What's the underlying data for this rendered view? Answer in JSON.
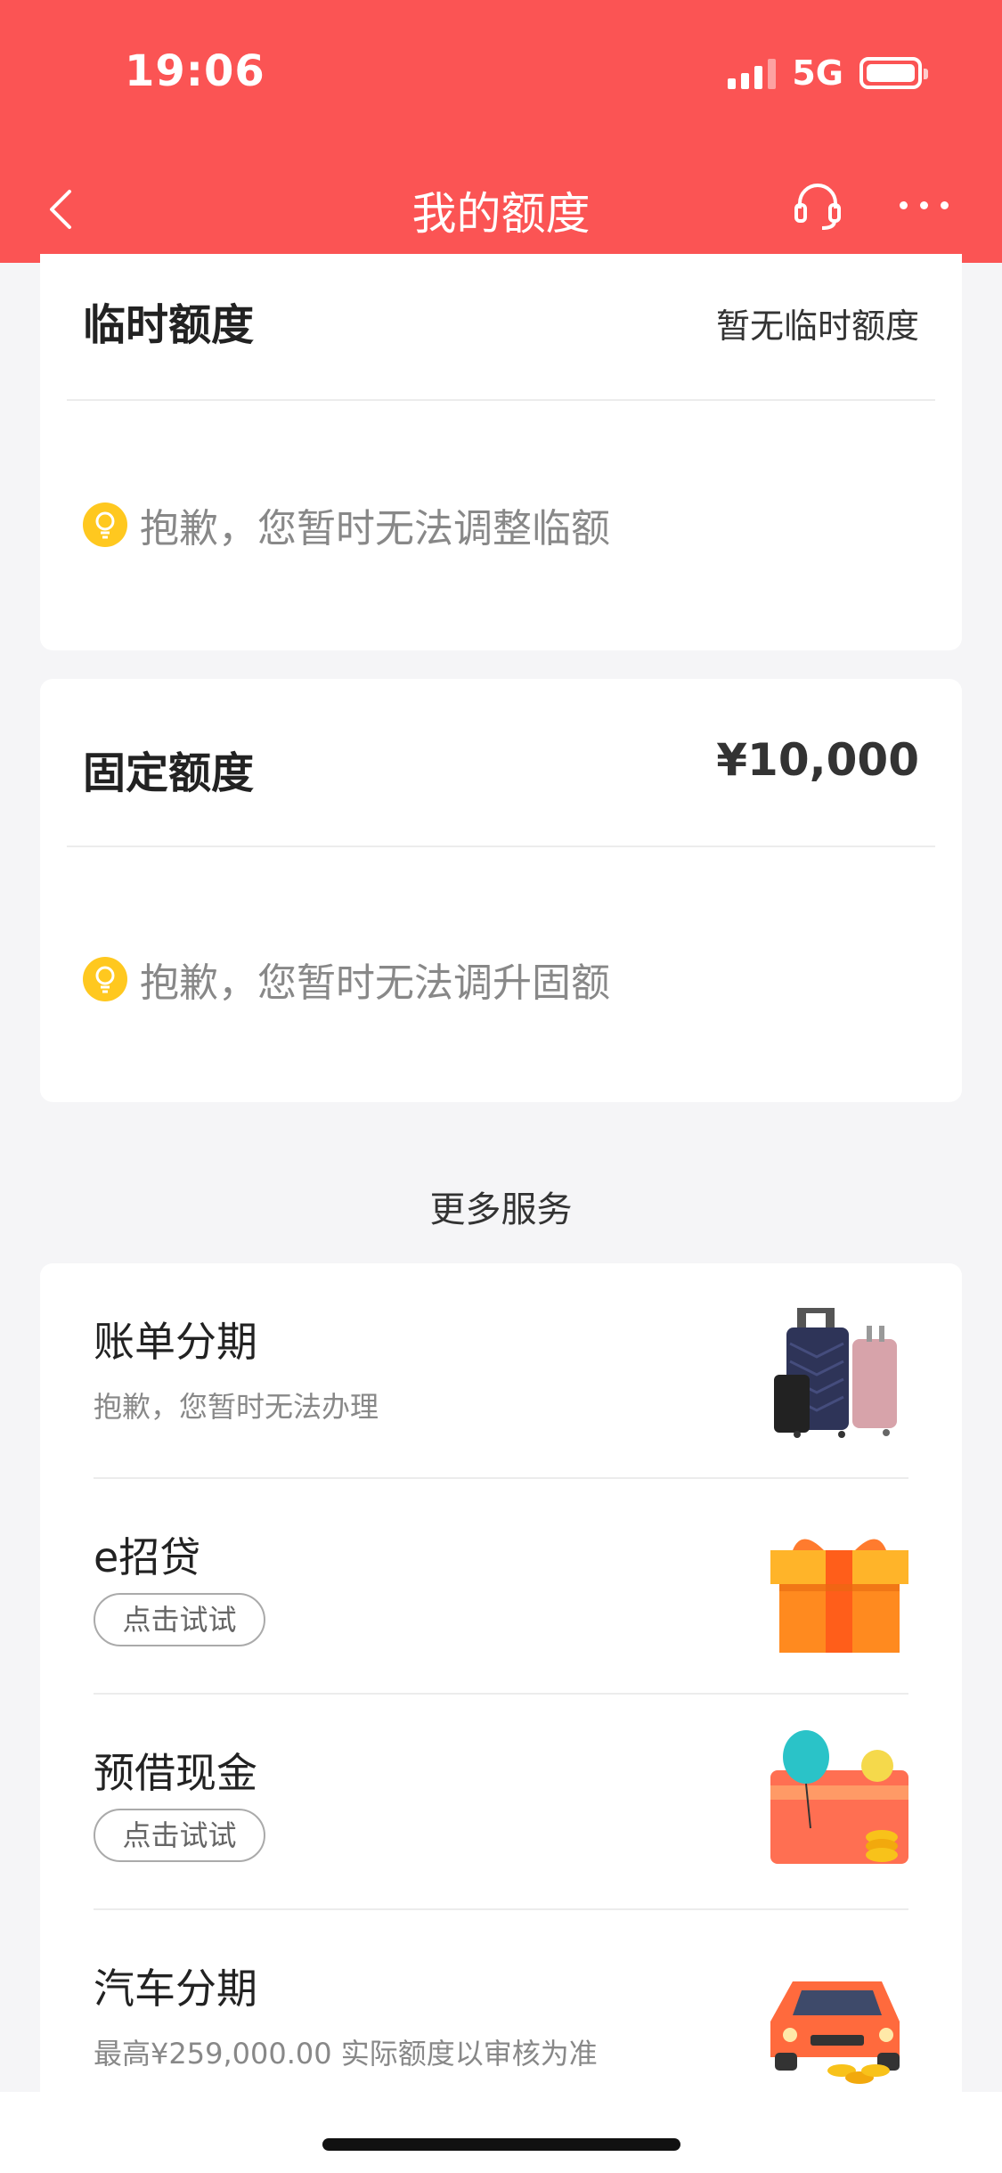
{
  "status_bar": {
    "time": "19:06",
    "network": "5G"
  },
  "nav": {
    "title": "我的额度"
  },
  "temp_quota": {
    "title": "临时额度",
    "status": "暂无临时额度",
    "tip": "抱歉，您暂时无法调整临额"
  },
  "fixed_quota": {
    "title": "固定额度",
    "amount": "¥10,000",
    "tip": "抱歉，您暂时无法调升固额"
  },
  "more_services": {
    "title": "更多服务",
    "items": [
      {
        "title": "账单分期",
        "subtitle": "抱歉，您暂时无法办理",
        "icon": "luggage-icon"
      },
      {
        "title": "e招贷",
        "button": "点击试试",
        "icon": "gift-box-icon"
      },
      {
        "title": "预借现金",
        "button": "点击试试",
        "icon": "cash-card-icon"
      },
      {
        "title": "汽车分期",
        "subtitle": "最高¥259,000.00 实际额度以审核为准",
        "icon": "car-icon"
      }
    ]
  },
  "colors": {
    "brand": "#fb5454",
    "tip_bulb": "#ffc81f"
  }
}
